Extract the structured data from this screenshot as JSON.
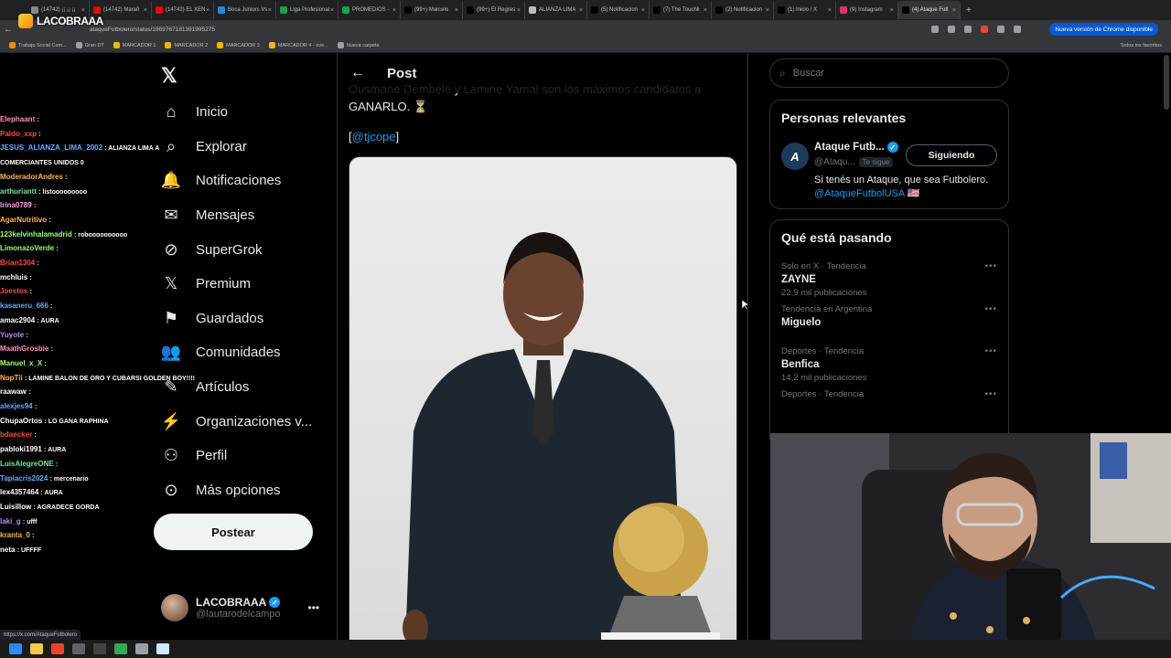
{
  "browser": {
    "tabs": [
      {
        "label": "(14742) ¡¡ ¡¡ ¡¡",
        "fav": "#888888"
      },
      {
        "label": "(14742) Marañ",
        "fav": "#ff0000"
      },
      {
        "label": "(14742) EL XEN",
        "fav": "#ff0000"
      },
      {
        "label": "Boca Juniors Vs",
        "fav": "#1e88e5"
      },
      {
        "label": "Liga Profesional",
        "fav": "#16a34a"
      },
      {
        "label": "PROMEDIOS -",
        "fav": "#16a34a"
      },
      {
        "label": "(99+) Marcelo",
        "fav": "#000000"
      },
      {
        "label": "(99+) El Regres",
        "fav": "#000000"
      },
      {
        "label": "ALIANZA LIMA",
        "fav": "#bdbdbd"
      },
      {
        "label": "(5) Notificacion",
        "fav": "#000000"
      },
      {
        "label": "(7) The Touchli",
        "fav": "#000000"
      },
      {
        "label": "(2) Notificacion",
        "fav": "#000000"
      },
      {
        "label": "(1) Inicio / X",
        "fav": "#000000"
      },
      {
        "label": "(9) Instagram",
        "fav": "#e1306c"
      },
      {
        "label": "(4) Ataque Futl",
        "fav": "#000000"
      }
    ],
    "url": "ataqueFutbolero/status/1969767181391995275",
    "update_label": "Nueva versión de Chrome disponible",
    "bookmarks": [
      {
        "label": "Trabajo Social Com...",
        "color": "#f28c00"
      },
      {
        "label": "Gran DT",
        "color": "#9aa0a6"
      },
      {
        "label": "MARCADOR 1",
        "color": "#f2b600"
      },
      {
        "label": "MARCADOR 2",
        "color": "#f2b600"
      },
      {
        "label": "MARCADOR 3",
        "color": "#f2b600"
      },
      {
        "label": "MARCADOR 4 - ove...",
        "color": "#f2b600"
      },
      {
        "label": "Nueva carpeta",
        "color": "#9aa0a6"
      }
    ],
    "all_bookmarks": "Todos los favoritos",
    "status_url": "https://x.com/AtaqueFutbolero"
  },
  "stream": {
    "logo_text": "LACOBRAAA"
  },
  "chat": [
    {
      "user": "Elephaant",
      "msg": ":",
      "color": "#ff8fb3"
    },
    {
      "user": "Paldo_xxp",
      "msg": ":",
      "color": "#ff4a4a"
    },
    {
      "user": "JESUS_ALIANZA_LIMA_2002",
      "msg": ": ALIANZA LIMA A",
      "color": "#6aa8ff"
    },
    {
      "user": "",
      "msg": "COMERCIANTES UNIDOS 0",
      "color": "#ffffff"
    },
    {
      "user": "ModeradorAndres",
      "msg": ":",
      "color": "#ffb84a"
    },
    {
      "user": "arthuriantt",
      "msg": ": listooooooooo",
      "color": "#6fe8a1"
    },
    {
      "user": "Irina0789",
      "msg": ":",
      "color": "#ff9fe0"
    },
    {
      "user": "AgarNutritivo",
      "msg": ":",
      "color": "#ffb84a"
    },
    {
      "user": "123kelvinhalamadrid",
      "msg": ": roboooooooooo",
      "color": "#9dff6a"
    },
    {
      "user": "LimonazoVerde",
      "msg": ":",
      "color": "#9dff6a"
    },
    {
      "user": "Brian1304",
      "msg": ":",
      "color": "#ff4a4a"
    },
    {
      "user": "mchluis",
      "msg": ":",
      "color": "#ffffff"
    },
    {
      "user": "Joestos",
      "msg": ":",
      "color": "#ff4a4a"
    },
    {
      "user": "kasaneru_666",
      "msg": ":",
      "color": "#6aa8ff"
    },
    {
      "user": "amac2904",
      "msg": ": AURA",
      "color": "#ffffff"
    },
    {
      "user": "Yuyote",
      "msg": ":",
      "color": "#b98aff"
    },
    {
      "user": "MaathGrosbie",
      "msg": ":",
      "color": "#ff8fb3"
    },
    {
      "user": "Manuel_x_X",
      "msg": ":",
      "color": "#9dff6a"
    },
    {
      "user": "NopTii",
      "msg": ": LAMINE BALON DE ORO Y CUBARSI GOLDEN BOY!!!!",
      "color": "#ffb84a"
    },
    {
      "user": "raawaw",
      "msg": ":",
      "color": "#ffffff"
    },
    {
      "user": "alexjes94",
      "msg": ":",
      "color": "#6aa8ff"
    },
    {
      "user": "ChupaOrtos",
      "msg": ": LO GANA RAPHINA",
      "color": "#ffffff"
    },
    {
      "user": "bdaecker",
      "msg": ":",
      "color": "#ff4a4a"
    },
    {
      "user": "pabloki1991",
      "msg": ": AURA",
      "color": "#ffffff"
    },
    {
      "user": "LuisAlegreONE",
      "msg": ":",
      "color": "#6fe8a1"
    },
    {
      "user": "Tapiacris2024",
      "msg": ": mercenario",
      "color": "#6aa8ff"
    },
    {
      "user": "lex4357464",
      "msg": ": AURA",
      "color": "#ffffff"
    },
    {
      "user": "Luisillow",
      "msg": ": AGRADECE GORDA",
      "color": "#ffffff"
    },
    {
      "user": "laki_g",
      "msg": ": ufff",
      "color": "#b98aff"
    },
    {
      "user": "kranta_0",
      "msg": ":",
      "color": "#ffb84a"
    },
    {
      "user": "neta",
      "msg": ": UFFFF",
      "color": "#ffffff"
    }
  ],
  "nav": {
    "items": [
      {
        "label": "Inicio",
        "icon": "home-icon",
        "glyph": "⌂"
      },
      {
        "label": "Explorar",
        "icon": "search-icon",
        "glyph": "⌕"
      },
      {
        "label": "Notificaciones",
        "icon": "bell-icon",
        "glyph": "🔔"
      },
      {
        "label": "Mensajes",
        "icon": "mail-icon",
        "glyph": "✉"
      },
      {
        "label": "SuperGrok",
        "icon": "grok-icon",
        "glyph": "⊘"
      },
      {
        "label": "Premium",
        "icon": "x-icon",
        "glyph": "𝕏"
      },
      {
        "label": "Guardados",
        "icon": "bookmark-icon",
        "glyph": "⚑"
      },
      {
        "label": "Comunidades",
        "icon": "people-icon",
        "glyph": "👥"
      },
      {
        "label": "Artículos",
        "icon": "article-icon",
        "glyph": "✎"
      },
      {
        "label": "Organizaciones v...",
        "icon": "lightning-icon",
        "glyph": "⚡"
      },
      {
        "label": "Perfil",
        "icon": "person-icon",
        "glyph": "⚇"
      },
      {
        "label": "Más opciones",
        "icon": "more-circle-icon",
        "glyph": "⊙"
      }
    ],
    "post_button": "Postear",
    "x_logo": "𝕏"
  },
  "account": {
    "name": "LACOBRAAA",
    "handle": "@lautarodelcampo"
  },
  "post": {
    "header_title": "Post",
    "text": "Ousmane Dembélé y Lamine Yamal son los máximos candidatos a GANARLO. ⏳",
    "mention_open": "[",
    "mention": "@tjcope",
    "mention_close": "]"
  },
  "right": {
    "search_placeholder": "Buscar",
    "relevant": {
      "title": "Personas relevantes",
      "name": "Ataque Futb...",
      "handle": "@Ataqu...",
      "follows_you": "Te sigue",
      "button": "Siguiendo",
      "bio": "Si tenés un Ataque, que sea Futbolero.",
      "bio_link": "@AtaqueFutbolUSA",
      "bio_flag": "🇺🇸"
    },
    "trends_title": "Qué está pasando",
    "trends": [
      {
        "meta": "Solo en X · Tendencia",
        "name": "ZAYNE",
        "count": "22,9 mil publicaciones"
      },
      {
        "meta": "Tendencia en Argentina",
        "name": "Miguelo",
        "count": ""
      },
      {
        "meta": "Deportes · Tendencia",
        "name": "Benfica",
        "count": "14,2 mil publicaciones"
      },
      {
        "meta": "Deportes · Tendencia",
        "name": "",
        "count": ""
      }
    ]
  },
  "taskbar": {
    "icons": [
      {
        "name": "windows-icon",
        "color": "#2b8bff"
      },
      {
        "name": "folder-icon",
        "color": "#f2c94c"
      },
      {
        "name": "chrome-icon",
        "color": "#e94235"
      },
      {
        "name": "app-icon",
        "color": "#5f6368"
      },
      {
        "name": "obs-icon",
        "color": "#444444"
      },
      {
        "name": "chrome-alt-icon",
        "color": "#34a853"
      },
      {
        "name": "tool-icon",
        "color": "#9aa0a6"
      },
      {
        "name": "notes-icon",
        "color": "#cfe8ff"
      }
    ]
  }
}
